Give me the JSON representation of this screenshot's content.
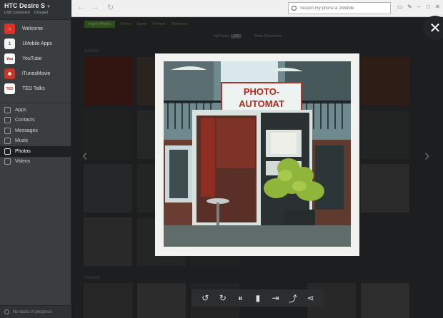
{
  "sidebar": {
    "device_name": "HTC Desire S",
    "status_left": "USB Connected",
    "status_right": "Charged",
    "apps": [
      {
        "label": "Welcome",
        "icon": "home-icon",
        "color": "#d8342a"
      },
      {
        "label": "1Mobile Apps",
        "icon": "1mobile-icon",
        "color": "#4caf50"
      },
      {
        "label": "YouTube",
        "icon": "youtube-icon",
        "color": "#ffffff"
      },
      {
        "label": "iTunesMovie",
        "icon": "itunes-movie-icon",
        "color": "#c0392b"
      },
      {
        "label": "TED Talks",
        "icon": "ted-icon",
        "color": "#e62b1e"
      }
    ],
    "sections": [
      {
        "label": "Apps",
        "icon": "apps-icon"
      },
      {
        "label": "Contacts",
        "icon": "contacts-icon"
      },
      {
        "label": "Messages",
        "icon": "messages-icon"
      },
      {
        "label": "Music",
        "icon": "music-icon"
      },
      {
        "label": "Photos",
        "icon": "photos-icon",
        "active": true
      },
      {
        "label": "Videos",
        "icon": "videos-icon"
      }
    ],
    "footer": "No tasks in progress"
  },
  "topbar": {
    "search_placeholder": "Search my phone & 1Mobile"
  },
  "content": {
    "import_label": "Import Photos",
    "links": [
      "Delete",
      "Export",
      "Refresh",
      "Slideshow"
    ],
    "tabs": [
      {
        "label": "MyPhotos",
        "count": "120"
      },
      {
        "label": "Photo Directories",
        "count": ""
      }
    ],
    "group_label": "5/1/2013",
    "group_label_2": "3/12/2013"
  },
  "viewer": {
    "sign_line1": "PHOTO-",
    "sign_line2": "AUTOMAT",
    "actions": [
      {
        "name": "rotate-left-icon",
        "glyph": "↺"
      },
      {
        "name": "rotate-right-icon",
        "glyph": "↻"
      },
      {
        "name": "pause-icon",
        "glyph": "⏸"
      },
      {
        "name": "delete-icon",
        "glyph": "🗑"
      },
      {
        "name": "export-icon",
        "glyph": "⇥"
      },
      {
        "name": "set-wallpaper-icon",
        "glyph": "⤴"
      },
      {
        "name": "share-icon",
        "glyph": "⋖"
      }
    ]
  }
}
